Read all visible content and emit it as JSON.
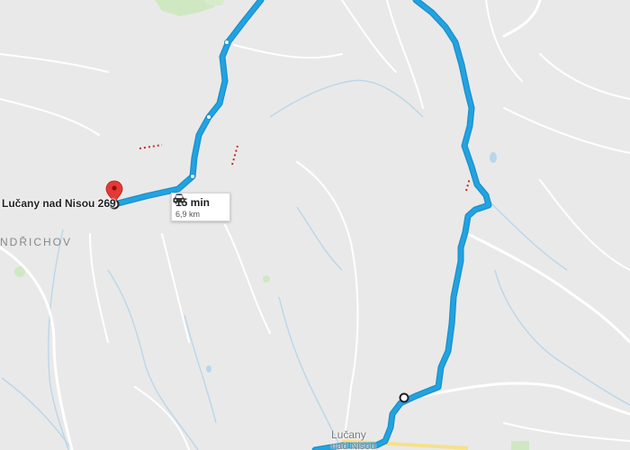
{
  "map": {
    "destination_label": "Lučany nad Nisou 269",
    "place_labels": {
      "jindrichov": "NDŘICHOV",
      "town_line1": "Lučany",
      "town_line2": "nad Nisou"
    },
    "route": {
      "duration": "15 min",
      "distance": "6,9 km",
      "mode_icon": "car-icon",
      "color": "#22a3e0"
    },
    "pin_color": "#e53935"
  }
}
